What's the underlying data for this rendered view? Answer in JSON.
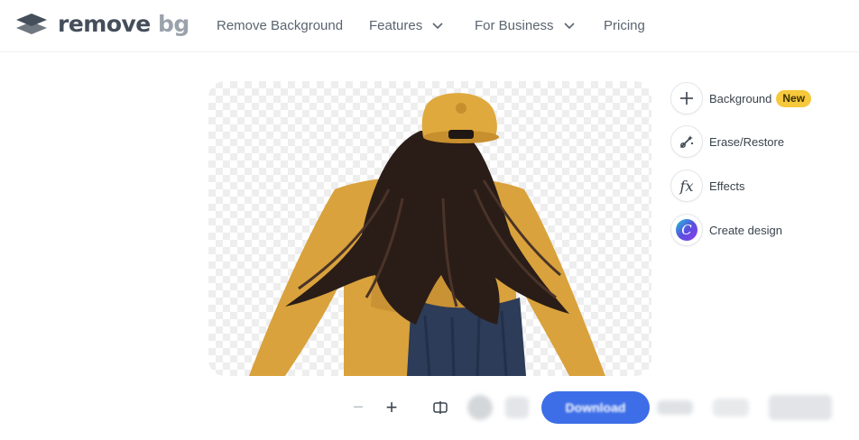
{
  "brand": {
    "name_bold": "remove",
    "name_light": "bg"
  },
  "nav": {
    "items": [
      {
        "label": "Remove Background",
        "dropdown": false
      },
      {
        "label": "Features",
        "dropdown": true
      },
      {
        "label": "For Business",
        "dropdown": true
      },
      {
        "label": "Pricing",
        "dropdown": false
      }
    ]
  },
  "editor": {
    "tools": [
      {
        "label": "Background",
        "icon": "plus-icon",
        "badge": "New"
      },
      {
        "label": "Erase/Restore",
        "icon": "magic-brush-icon"
      },
      {
        "label": "Effects",
        "icon": "fx-icon",
        "glyph": "fx"
      },
      {
        "label": "Create design",
        "icon": "canva-icon",
        "glyph": "C"
      }
    ],
    "zoom_out_glyph": "−",
    "zoom_in_glyph": "+",
    "download_label": "Download"
  },
  "colors": {
    "accent": "#3d6ee8",
    "badge": "#f6c83c",
    "text": "#454f5b"
  }
}
